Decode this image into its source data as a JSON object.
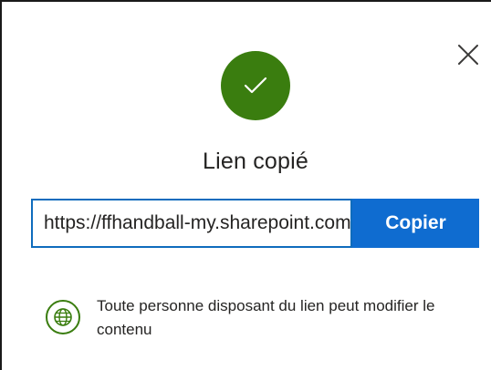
{
  "dialog": {
    "title": "Lien copié",
    "close_icon": "close-icon",
    "success_icon": "checkmark-icon",
    "success_color": "#3a7d0f"
  },
  "link": {
    "url": "https://ffhandball-my.sharepoint.com/",
    "copy_label": "Copier",
    "accent_color": "#0f6cd0"
  },
  "permission": {
    "icon": "globe-icon",
    "text": "Toute personne disposant du lien peut modifier le contenu"
  }
}
